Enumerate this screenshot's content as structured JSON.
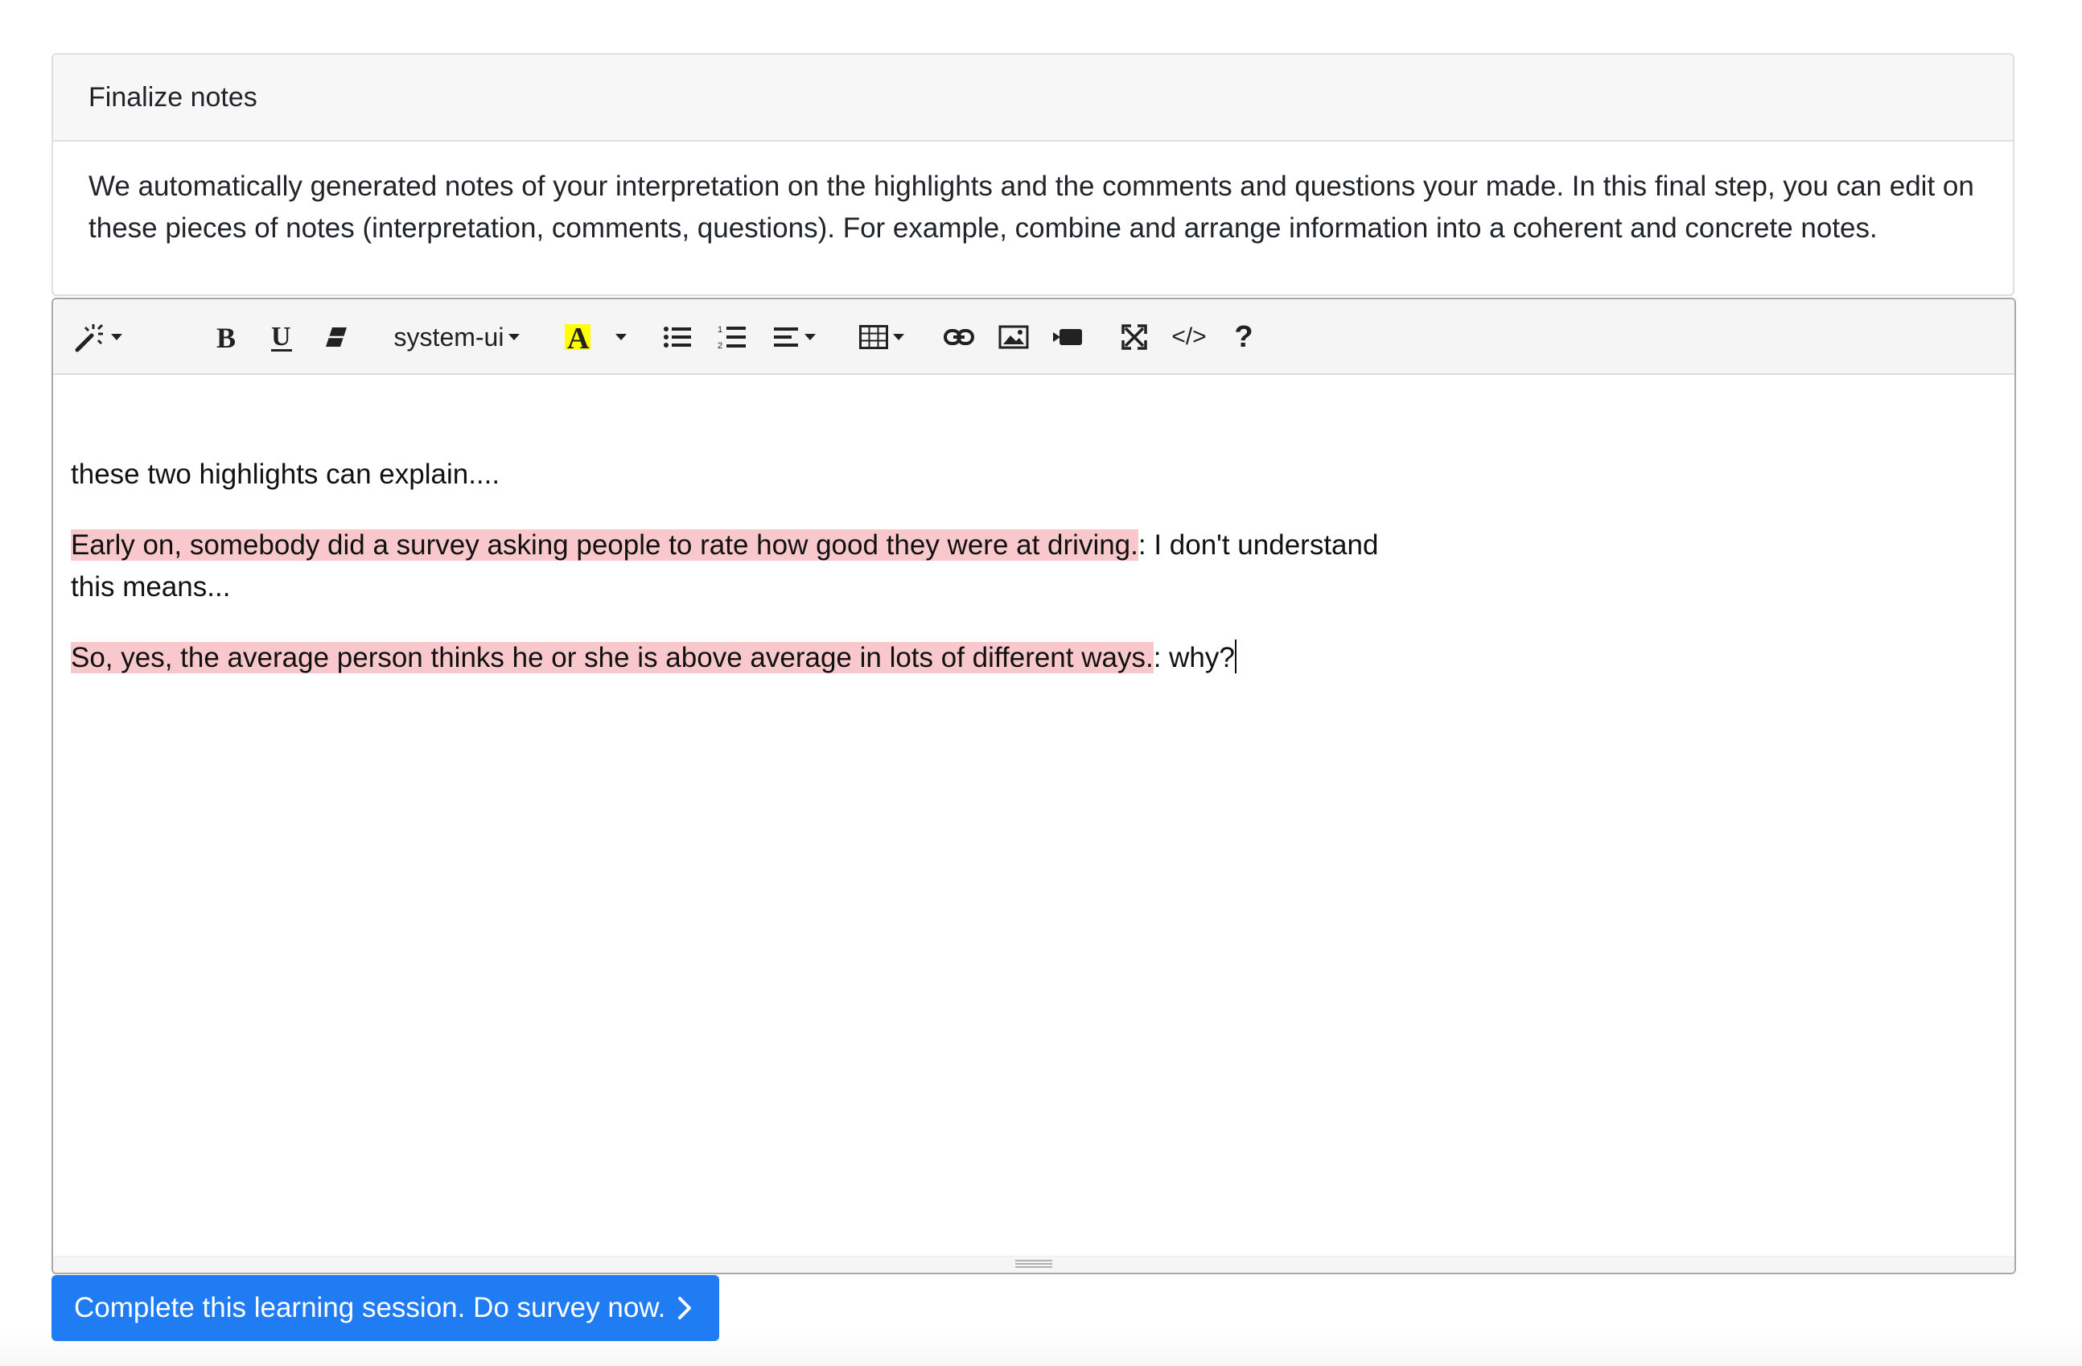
{
  "card": {
    "title": "Finalize notes",
    "description": "We automatically generated notes of your interpretation on the highlights and the comments and questions your made. In this final step, you can edit on these pieces of notes (interpretation, comments, questions). For example, combine and arrange information into a coherent and concrete notes."
  },
  "toolbar": {
    "style_icon": "magic-wand-icon",
    "bold_icon": "bold-icon",
    "underline_icon": "underline-icon",
    "eraser_icon": "eraser-icon",
    "font_name": "system-ui",
    "color_icon": "font-color-icon",
    "color_highlight": "#ffff00",
    "ul_icon": "unordered-list-icon",
    "ol_icon": "ordered-list-icon",
    "align_icon": "align-icon",
    "table_icon": "table-icon",
    "link_icon": "link-icon",
    "image_icon": "image-icon",
    "video_icon": "video-icon",
    "fullscreen_icon": "fullscreen-icon",
    "code_label": "</>",
    "help_label": "?"
  },
  "editor": {
    "line1": "these two highlights can explain....",
    "note1": {
      "highlight": "Early on, somebody did a survey asking people to rate how good they were at driving.",
      "comment_line1": ": I don't understand",
      "comment_line2": "this means..."
    },
    "note2": {
      "highlight": "So, yes, the average person thinks he or she is above average in lots of different ways.",
      "comment": ": why?"
    },
    "highlight_color": "#f8c8cc"
  },
  "complete_button": {
    "label": "Complete this learning session. Do survey now.",
    "color": "#1f7cf2"
  }
}
